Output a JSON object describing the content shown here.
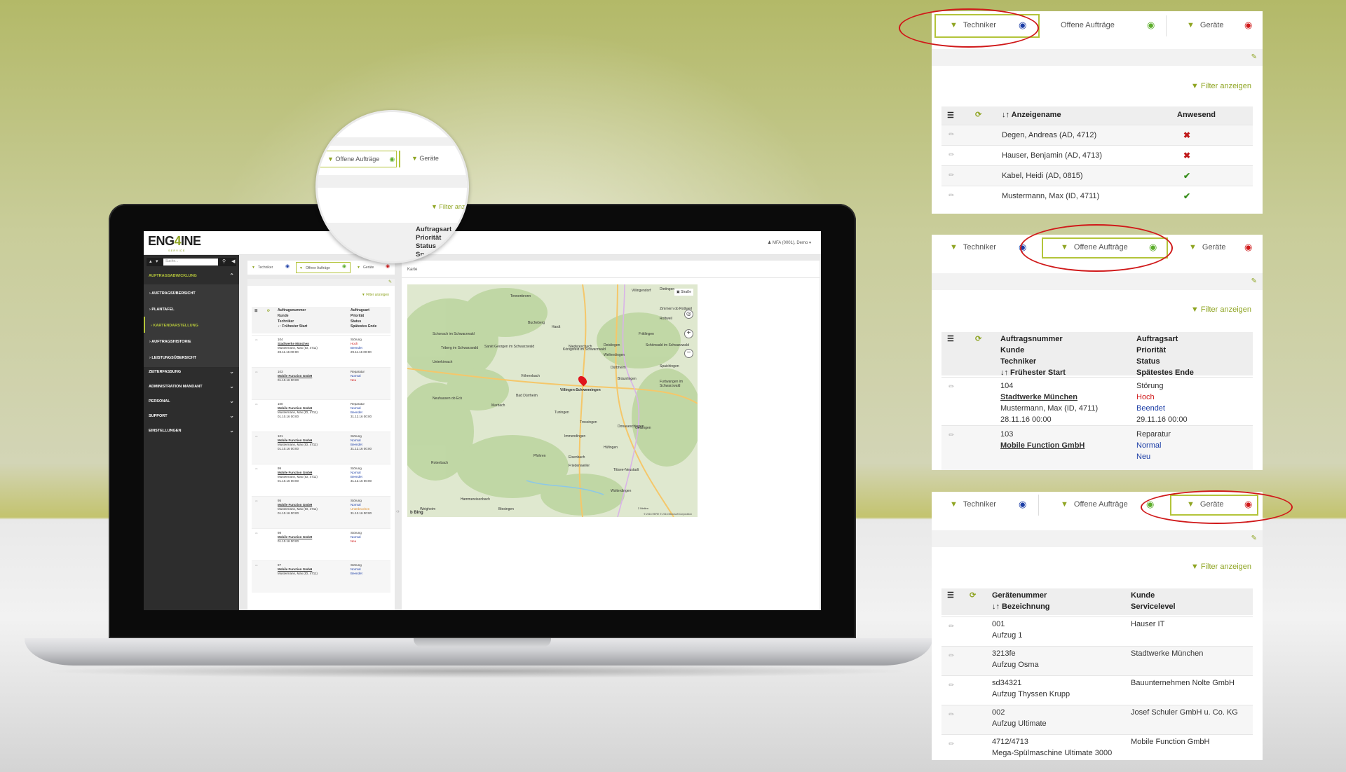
{
  "app": {
    "logo_left": "ENG",
    "logo_mid": "4",
    "logo_right": "INE",
    "logo_sub": "SERVICE",
    "user": "MFA (0001), Demo ▾",
    "search_placeholder": "Suche..."
  },
  "sidebar": {
    "section": "Auftragsabwicklung",
    "subitems": [
      "Auftragsübersicht",
      "Plantafel",
      "Kartendarstellung",
      "Auftragshistorie",
      "Leistungsübersicht"
    ],
    "groups": [
      "Zeiterfassung",
      "Administration Mandant",
      "Personal",
      "Support",
      "Einstellungen"
    ]
  },
  "tabs": {
    "techniker": "Techniker",
    "offene": "Offene Aufträge",
    "geraete": "Geräte"
  },
  "filter_label": "Filter anzeigen",
  "orders_list": {
    "col1": [
      "Auftragsnummer",
      "Kunde",
      "Techniker",
      "↓↑ Frühester Start"
    ],
    "col2": [
      "Auftragsart",
      "Priorität",
      "Status",
      "Spätestes Ende"
    ],
    "rows": [
      {
        "nr": "104",
        "kunde": "Stadtwerke München",
        "tech": "Mustermann, Max (ID, 4711)",
        "start": "28.11.16 00:00",
        "art": "Störung",
        "prio": "Hoch",
        "status": "Beendet",
        "ende": "29.11.16 00:00"
      },
      {
        "nr": "103",
        "kunde": "Mobile Function GmbH",
        "tech": "",
        "start": "01.10.16 00:00",
        "art": "Reparatur",
        "prio": "Normal",
        "status": "Neu",
        "ende": ""
      },
      {
        "nr": "100",
        "kunde": "Mobile Function GmbH",
        "tech": "Mustermann, Max (ID, 4711)",
        "start": "01.10.16 00:00",
        "art": "Reparatur",
        "prio": "Normal",
        "status": "Beendet",
        "ende": "31.12.16 00:00"
      },
      {
        "nr": "101",
        "kunde": "Mobile Function GmbH",
        "tech": "Mustermann, Max (ID, 4711)",
        "start": "01.10.16 00:00",
        "art": "Störung",
        "prio": "Normal",
        "status": "Beendet",
        "ende": "31.12.16 00:00"
      },
      {
        "nr": "99",
        "kunde": "Mobile Function GmbH",
        "tech": "Mustermann, Max (ID, 4711)",
        "start": "01.10.16 00:00",
        "art": "Störung",
        "prio": "Normal",
        "status": "Beendet",
        "ende": "31.12.16 00:00"
      },
      {
        "nr": "95",
        "kunde": "Mobile Function GmbH",
        "tech": "Mustermann, Max (ID, 4711)",
        "start": "01.10.16 00:00",
        "art": "Störung",
        "prio": "Normal",
        "status": "Unterbrochen",
        "ende": "31.12.16 00:00"
      },
      {
        "nr": "98",
        "kunde": "Mobile Function GmbH",
        "tech": "",
        "start": "01.10.16 00:00",
        "art": "Störung",
        "prio": "Normal",
        "status": "Neu",
        "ende": ""
      },
      {
        "nr": "97",
        "kunde": "Mobile Function GmbH",
        "tech": "Mustermann, Max (ID, 4711)",
        "start": "",
        "art": "Störung",
        "prio": "Normal",
        "status": "Beendet",
        "ende": ""
      }
    ]
  },
  "map": {
    "panel_title": "Karte",
    "layer_label": "Straße",
    "marker_label": "Villingen-Schwenningen",
    "places": [
      "Tennenbronn",
      "Bucheberg",
      "Hardt",
      "Villingendorf",
      "Dietingen",
      "Zimmern ob Rottweil",
      "Rottweil",
      "Schonach im Schwarzwald",
      "Triberg im Schwarzwald",
      "Sankt Georgen im Schwarzwald",
      "Königsfeld im Schwarzwald",
      "Niedereschach",
      "Deislingen",
      "Wellendingen",
      "Frittlingen",
      "Schönwald im Schwarzwald",
      "Unterkirnach",
      "Dürbheim",
      "Spaichingen",
      "Furtwangen im Schwarzwald",
      "Vöhrenbach",
      "Neuhausen ob Eck",
      "Marbach",
      "Bad Dürrheim",
      "Tuningen",
      "Trossingen",
      "Bräunlingen",
      "Donaueschingen",
      "Geisingen",
      "Immendingen",
      "Hüfingen",
      "Pfohren",
      "Eisenbach",
      "Friedenweiler",
      "Titisee-Neustadt",
      "Rotenbach",
      "Hammereisenbach",
      "Wolterdingen",
      "Weigheim",
      "Biesingen"
    ],
    "copyright": "© 2016 HERE © 2016 Microsoft Corporation",
    "scale": "2 Meilen",
    "bing": "Bing"
  },
  "magnifier": {
    "tab": "Offene Aufträge",
    "tab2": "Geräte",
    "filter": "Filter anz",
    "cols": [
      "Auftragsart",
      "Priorität",
      "Status",
      "Sp"
    ]
  },
  "panel_techniker": {
    "columns": {
      "sort": "↓↑",
      "name": "Anzeigename",
      "present": "Anwesend"
    },
    "rows": [
      {
        "name": "Degen, Andreas (AD, 4712)",
        "present": false
      },
      {
        "name": "Hauser, Benjamin (AD, 4713)",
        "present": false
      },
      {
        "name": "Kabel, Heidi (AD, 0815)",
        "present": true
      },
      {
        "name": "Mustermann, Max (ID, 4711)",
        "present": true
      }
    ]
  },
  "panel_auftraege": {
    "col1": [
      "Auftragsnummer",
      "Kunde",
      "Techniker",
      "↓↑ Frühester Start"
    ],
    "col2": [
      "Auftragsart",
      "Priorität",
      "Status",
      "Spätestes Ende"
    ],
    "row1": {
      "nr": "104",
      "kunde": "Stadtwerke München",
      "tech": "Mustermann, Max (ID, 4711)",
      "start": "28.11.16 00:00",
      "art": "Störung",
      "prio": "Hoch",
      "status": "Beendet",
      "ende": "29.11.16 00:00"
    },
    "row2": {
      "nr": "103",
      "kunde": "Mobile Function GmbH",
      "art": "Reparatur",
      "prio": "Normal",
      "status": "Neu"
    }
  },
  "panel_geraete": {
    "col1": [
      "Gerätenummer",
      "↓↑ Bezeichnung"
    ],
    "col2": [
      "Kunde",
      "Servicelevel"
    ],
    "rows": [
      {
        "nr": "001",
        "bez": "Aufzug 1",
        "kunde": "Hauser IT"
      },
      {
        "nr": "3213fe",
        "bez": "Aufzug Osma",
        "kunde": "Stadtwerke München"
      },
      {
        "nr": "sd34321",
        "bez": "Aufzug Thyssen Krupp",
        "kunde": "Bauunternehmen Nolte GmbH"
      },
      {
        "nr": "002",
        "bez": "Aufzug Ultimate",
        "kunde": "Josef Schuler GmbH u. Co. KG"
      },
      {
        "nr": "4712/4713",
        "bez": "Mega-Spülmaschine Ultimate 3000",
        "kunde": "Mobile Function GmbH"
      }
    ]
  },
  "colors": {
    "accent": "#8fa523",
    "highlight_red": "#d0191a",
    "eye_blue": "#1c3ea6",
    "eye_green": "#5cad2b"
  }
}
